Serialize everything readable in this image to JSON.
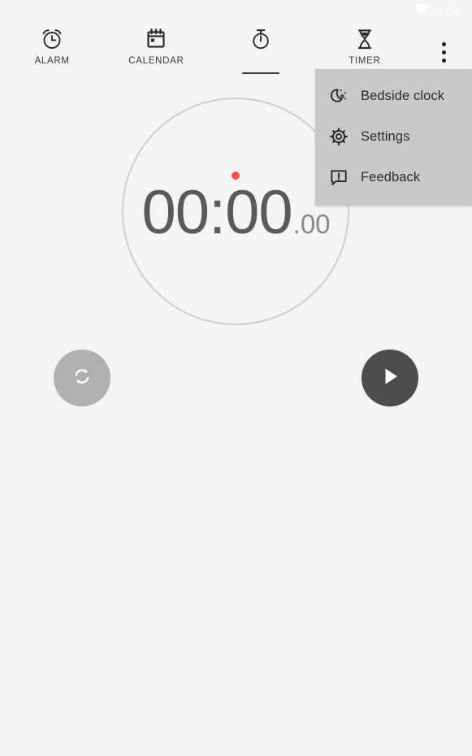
{
  "status_bar": {
    "time": "3:58",
    "wifi_icon": "wifi-icon",
    "text_color": "#ffffff"
  },
  "tabs": [
    {
      "label": "ALARM",
      "icon": "alarm-clock-icon",
      "selected": false
    },
    {
      "label": "CALENDAR",
      "icon": "calendar-icon",
      "selected": false
    },
    {
      "label": "",
      "icon": "stopwatch-icon",
      "selected": true
    },
    {
      "label": "TIMER",
      "icon": "hourglass-icon",
      "selected": false
    }
  ],
  "overflow": {
    "name": "more-options-button",
    "menu": {
      "items": [
        {
          "label": "Bedside clock",
          "icon": "moon-icon"
        },
        {
          "label": "Settings",
          "icon": "gear-icon"
        },
        {
          "label": "Feedback",
          "icon": "feedback-icon"
        }
      ],
      "background": "#c9c9c9"
    }
  },
  "stopwatch": {
    "time_main": "00:00",
    "time_fraction": ".00",
    "dial_color": "#cfcfcf",
    "marker_color": "#ef5350",
    "text_color": "#5a5a5a"
  },
  "actions": {
    "reset": {
      "label": "",
      "icon": "reset-icon",
      "color": "#b0b0b0"
    },
    "start": {
      "label": "",
      "icon": "play-icon",
      "color": "#4c4c4c"
    }
  },
  "theme": {
    "background": "#f4f4f4",
    "accent": "#ef5350"
  }
}
